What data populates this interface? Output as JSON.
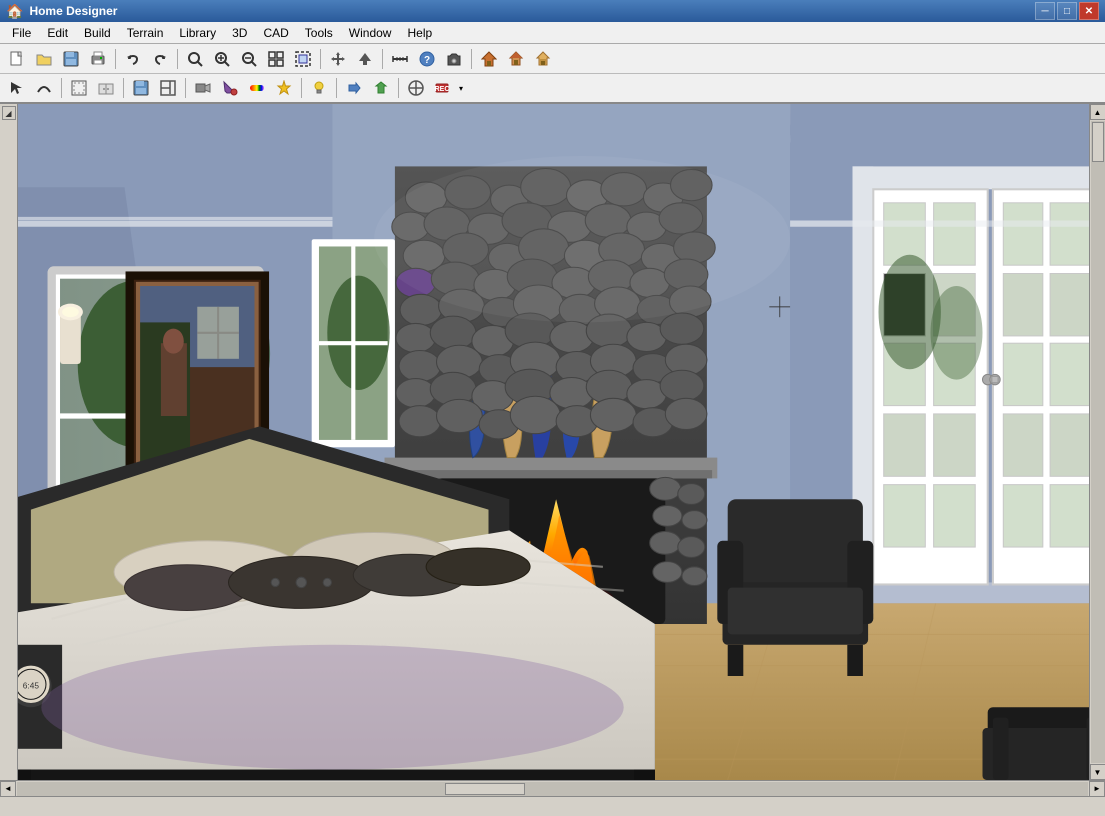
{
  "app": {
    "title": "Home Designer",
    "icon": "🏠"
  },
  "titlebar": {
    "minimize": "─",
    "maximize": "□",
    "close": "✕"
  },
  "menubar": {
    "items": [
      "File",
      "Edit",
      "Build",
      "Terrain",
      "Library",
      "3D",
      "CAD",
      "Tools",
      "Window",
      "Help"
    ]
  },
  "toolbar1": {
    "buttons": [
      {
        "name": "new",
        "icon": "📄",
        "label": "New"
      },
      {
        "name": "open",
        "icon": "📂",
        "label": "Open"
      },
      {
        "name": "save",
        "icon": "💾",
        "label": "Save"
      },
      {
        "name": "print",
        "icon": "🖨",
        "label": "Print"
      },
      {
        "name": "undo",
        "icon": "↩",
        "label": "Undo"
      },
      {
        "name": "redo",
        "icon": "↪",
        "label": "Redo"
      },
      {
        "name": "zoom-out-small",
        "icon": "🔍",
        "label": "Zoom"
      },
      {
        "name": "zoom-in",
        "icon": "🔎",
        "label": "Zoom In"
      },
      {
        "name": "zoom-out",
        "icon": "⊖",
        "label": "Zoom Out"
      },
      {
        "name": "zoom-fit",
        "icon": "⊞",
        "label": "Fit"
      },
      {
        "name": "zoom-select",
        "icon": "⊟",
        "label": "Zoom Select"
      },
      {
        "name": "panning",
        "icon": "✋",
        "label": "Pan"
      },
      {
        "name": "arrow-up",
        "icon": "↑",
        "label": "Arrow"
      },
      {
        "name": "measure",
        "icon": "📏",
        "label": "Measure"
      },
      {
        "name": "info",
        "icon": "ℹ",
        "label": "Info"
      },
      {
        "name": "camera",
        "icon": "📷",
        "label": "Camera"
      },
      {
        "name": "house1",
        "icon": "⌂",
        "label": "House1"
      },
      {
        "name": "house2",
        "icon": "🏠",
        "label": "House2"
      },
      {
        "name": "house3",
        "icon": "🏡",
        "label": "House3"
      }
    ]
  },
  "toolbar2": {
    "buttons": [
      {
        "name": "select",
        "icon": "↖",
        "label": "Select"
      },
      {
        "name": "curve",
        "icon": "∿",
        "label": "Curve"
      },
      {
        "name": "wall",
        "icon": "⊏",
        "label": "Wall"
      },
      {
        "name": "cabinet",
        "icon": "▦",
        "label": "Cabinet"
      },
      {
        "name": "stairs",
        "icon": "▤",
        "label": "Stairs"
      },
      {
        "name": "save2",
        "icon": "💾",
        "label": "Save"
      },
      {
        "name": "view3d",
        "icon": "◱",
        "label": "3D View"
      },
      {
        "name": "floor",
        "icon": "▣",
        "label": "Floor"
      },
      {
        "name": "camera2",
        "icon": "📷",
        "label": "Camera"
      },
      {
        "name": "paint",
        "icon": "🖌",
        "label": "Paint"
      },
      {
        "name": "rainbow",
        "icon": "🌈",
        "label": "Materials"
      },
      {
        "name": "magic",
        "icon": "✨",
        "label": "Magic"
      },
      {
        "name": "lighting",
        "icon": "💡",
        "label": "Lighting"
      },
      {
        "name": "arrow-right",
        "icon": "→",
        "label": "Arrow"
      },
      {
        "name": "up-arrow",
        "icon": "⬆",
        "label": "Up"
      },
      {
        "name": "pointer",
        "icon": "⊕",
        "label": "Pointer"
      },
      {
        "name": "record",
        "icon": "⏺",
        "label": "Record"
      }
    ]
  },
  "statusbar": {
    "text": ""
  },
  "scene": {
    "description": "3D bedroom interior view with fireplace, bed, and French doors"
  }
}
